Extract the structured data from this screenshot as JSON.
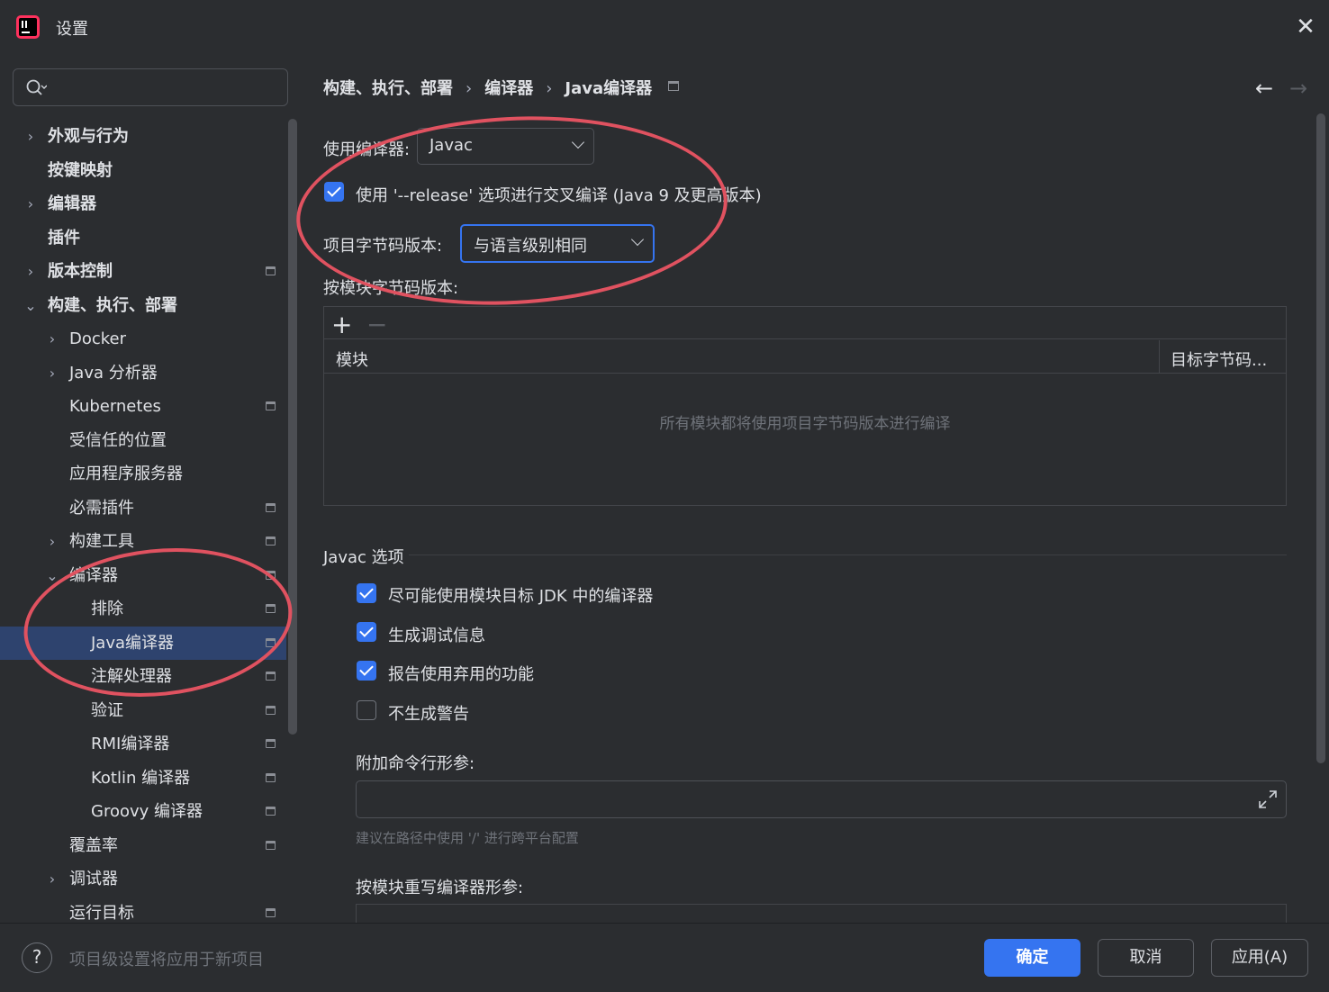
{
  "window": {
    "title": "设置",
    "close_glyph": "✕"
  },
  "icons": {
    "app": "intellij-logo-icon",
    "search": "search-icon",
    "close": "close-icon",
    "expand": "expand-icon",
    "help": "help-icon"
  },
  "colors": {
    "accent": "#3574f0",
    "selection": "#2e436e",
    "annotation": "#e05260",
    "background": "#2b2d30"
  },
  "sidebar": {
    "search_placeholder": "",
    "items": [
      {
        "label": "外观与行为",
        "chevron": "›",
        "bold": true
      },
      {
        "label": "按键映射",
        "chevron": "",
        "bold": true
      },
      {
        "label": "编辑器",
        "chevron": "›",
        "bold": true
      },
      {
        "label": "插件",
        "chevron": "",
        "bold": true
      },
      {
        "label": "版本控制",
        "chevron": "›",
        "bold": true
      },
      {
        "label": "构建、执行、部署",
        "chevron": "⌄",
        "bold": true
      },
      {
        "label": "Docker",
        "chevron": "›"
      },
      {
        "label": "Java 分析器",
        "chevron": "›"
      },
      {
        "label": "Kubernetes",
        "chevron": ""
      },
      {
        "label": "受信任的位置",
        "chevron": ""
      },
      {
        "label": "应用程序服务器",
        "chevron": ""
      },
      {
        "label": "必需插件",
        "chevron": ""
      },
      {
        "label": "构建工具",
        "chevron": "›"
      },
      {
        "label": "编译器",
        "chevron": "⌄"
      },
      {
        "label": "排除",
        "chevron": ""
      },
      {
        "label": "Java编译器",
        "chevron": "",
        "selected": true
      },
      {
        "label": "注解处理器",
        "chevron": ""
      },
      {
        "label": "验证",
        "chevron": ""
      },
      {
        "label": "RMI编译器",
        "chevron": ""
      },
      {
        "label": "Kotlin 编译器",
        "chevron": ""
      },
      {
        "label": "Groovy 编译器",
        "chevron": ""
      },
      {
        "label": "覆盖率",
        "chevron": ""
      },
      {
        "label": "调试器",
        "chevron": "›"
      },
      {
        "label": "运行目标",
        "chevron": ""
      }
    ]
  },
  "breadcrumb": {
    "parts": [
      "构建、执行、部署",
      "编译器",
      "Java编译器"
    ],
    "sep": "›"
  },
  "nav": {
    "back": "←",
    "forward": "→"
  },
  "main": {
    "compiler_label": "使用编译器:",
    "compiler_value": "Javac",
    "release_checkbox": "使用 '--release' 选项进行交叉编译 (Java 9 及更高版本)",
    "bytecode_label": "项目字节码版本:",
    "bytecode_value": "与语言级别相同",
    "per_module_label": "按模块字节码版本:",
    "table": {
      "add": "+",
      "remove": "−",
      "col_module": "模块",
      "col_target": "目标字节码...",
      "empty_text": "所有模块都将使用项目字节码版本进行编译"
    },
    "javac_section": "Javac 选项",
    "options": [
      {
        "label": "尽可能使用模块目标 JDK 中的编译器",
        "checked": true
      },
      {
        "label": "生成调试信息",
        "checked": true
      },
      {
        "label": "报告使用弃用的功能",
        "checked": true
      },
      {
        "label": "不生成警告",
        "checked": false
      }
    ],
    "extra_args_label": "附加命令行形参:",
    "extra_args_value": "",
    "hint": "建议在路径中使用 '/' 进行跨平台配置",
    "override_label": "按模块重写编译器形参:"
  },
  "footer": {
    "help": "?",
    "hint": "项目级设置将应用于新项目",
    "ok": "确定",
    "cancel": "取消",
    "apply": "应用(A)"
  }
}
